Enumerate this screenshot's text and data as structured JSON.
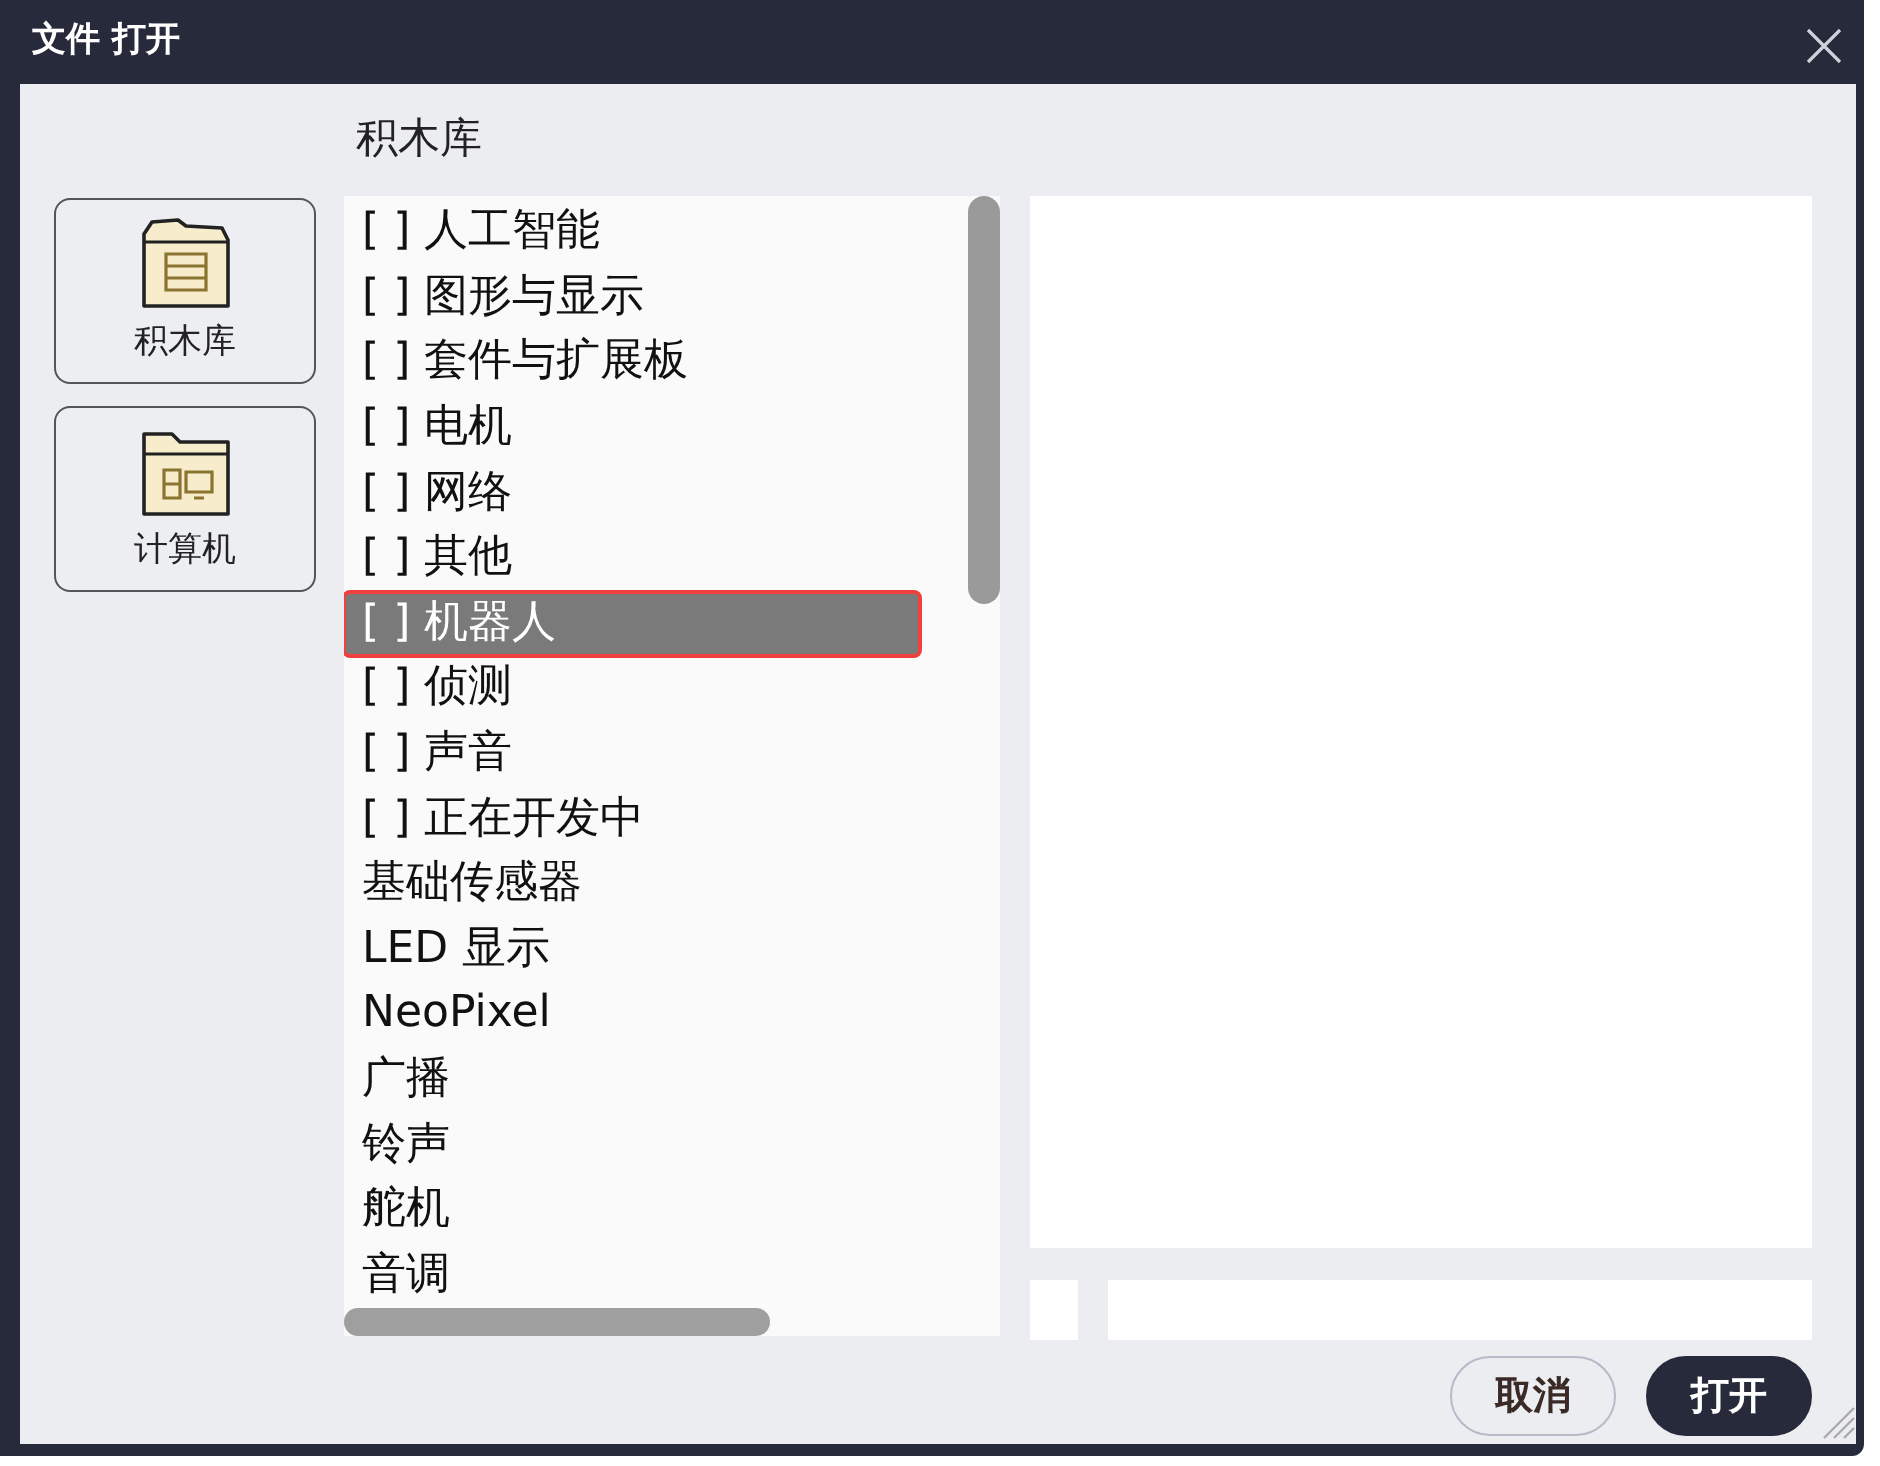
{
  "window": {
    "title": "文件 打开"
  },
  "header": "积木库",
  "sidebar": [
    {
      "label": "积木库"
    },
    {
      "label": "计算机"
    }
  ],
  "list": [
    {
      "label": "[ ] 人工智能",
      "selected": false
    },
    {
      "label": "[ ] 图形与显示",
      "selected": false
    },
    {
      "label": "[ ] 套件与扩展板",
      "selected": false
    },
    {
      "label": "[ ] 电机",
      "selected": false
    },
    {
      "label": "[ ] 网络",
      "selected": false
    },
    {
      "label": "[ ] 其他",
      "selected": false
    },
    {
      "label": "[ ] 机器人",
      "selected": true
    },
    {
      "label": "[ ] 侦测",
      "selected": false
    },
    {
      "label": "[ ] 声音",
      "selected": false
    },
    {
      "label": "[ ] 正在开发中",
      "selected": false
    },
    {
      "label": "基础传感器",
      "selected": false
    },
    {
      "label": "LED 显示",
      "selected": false
    },
    {
      "label": "NeoPixel",
      "selected": false
    },
    {
      "label": "广播",
      "selected": false
    },
    {
      "label": "铃声",
      "selected": false
    },
    {
      "label": "舵机",
      "selected": false
    },
    {
      "label": "音调",
      "selected": false
    }
  ],
  "buttons": [
    {
      "label": "取消",
      "kind": "secondary"
    },
    {
      "label": "打开",
      "kind": "primary"
    }
  ]
}
